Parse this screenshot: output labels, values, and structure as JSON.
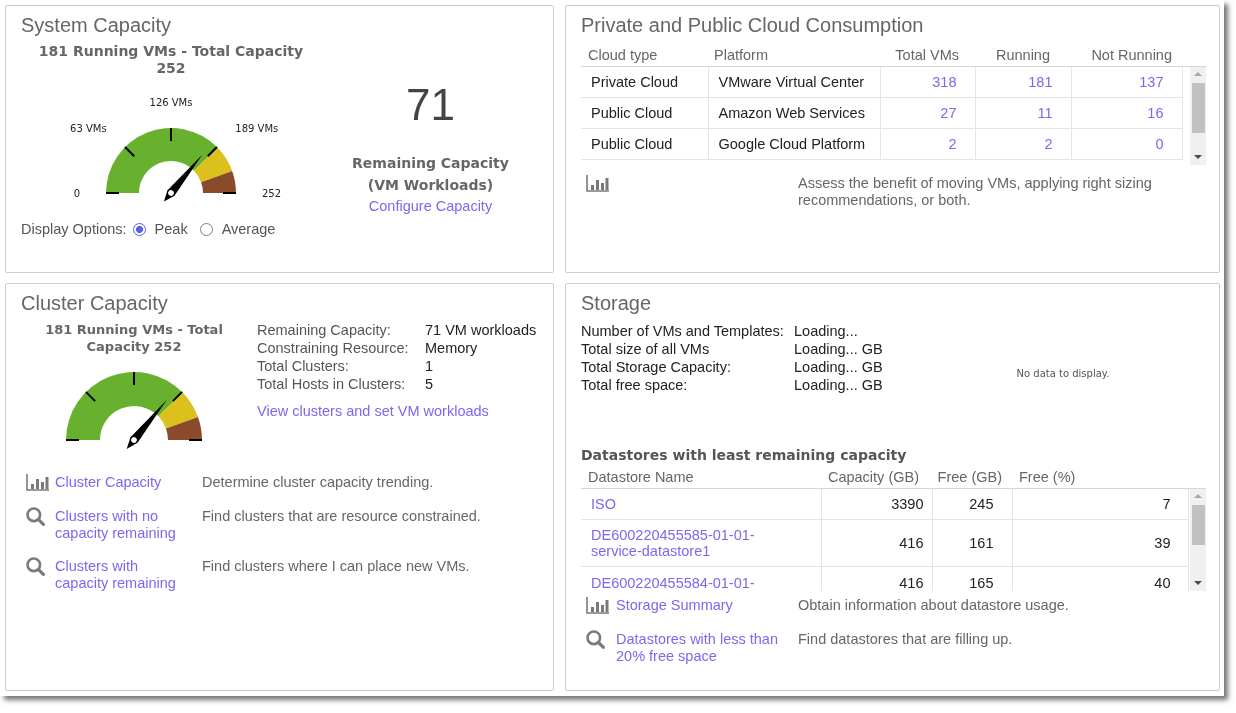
{
  "system_capacity": {
    "title": "System Capacity",
    "gauge": {
      "caption": "181 Running VMs - Total Capacity 252",
      "tick_labels": [
        "0",
        "63 VMs",
        "126 VMs",
        "189 VMs",
        "252"
      ],
      "level": 0.718
    },
    "display_options": {
      "label": "Display Options:",
      "options": [
        {
          "label": "Peak",
          "selected": true
        },
        {
          "label": "Average",
          "selected": false
        }
      ]
    },
    "remaining": {
      "value": "71",
      "label": "Remaining Capacity (VM Workloads)",
      "link": "Configure Capacity"
    }
  },
  "cloud_consumption": {
    "title": "Private and Public Cloud Consumption",
    "table": {
      "columns": [
        "Cloud type",
        "Platform",
        "Total VMs",
        "Running",
        "Not Running"
      ],
      "rows": [
        {
          "cloud_type": "Private Cloud",
          "platform": "VMware Virtual Center",
          "total_vms": "318",
          "running": "181",
          "not_running": "137"
        },
        {
          "cloud_type": "Public Cloud",
          "platform": "Amazon Web Services",
          "total_vms": "27",
          "running": "11",
          "not_running": "16"
        },
        {
          "cloud_type": "Public Cloud",
          "platform": "Google Cloud Platform",
          "total_vms": "2",
          "running": "2",
          "not_running": "0"
        }
      ]
    },
    "reports": [
      {
        "kind": "chart",
        "description": "Assess the benefit of moving VMs, applying right sizing recommendations, or both."
      }
    ]
  },
  "cluster_capacity": {
    "title": "Cluster Capacity",
    "gauge": {
      "caption": "181 Running VMs - Total Capacity 252",
      "level": 0.718
    },
    "details": [
      {
        "label": "Remaining Capacity:",
        "value": "71 VM workloads"
      },
      {
        "label": "Constraining Resource:",
        "value": "Memory"
      },
      {
        "label": "Total Clusters:",
        "value": "1"
      },
      {
        "label": "Total Hosts in Clusters:",
        "value": "5"
      }
    ],
    "link": "View clusters and set VM workloads",
    "reports": [
      {
        "kind": "chart",
        "link": "Cluster Capacity",
        "description": "Determine cluster capacity trending."
      },
      {
        "kind": "search",
        "link": "Clusters with no capacity remaining",
        "description": "Find clusters that are resource constrained."
      },
      {
        "kind": "search",
        "link": "Clusters with capacity remaining",
        "description": "Find clusters where I can place new VMs."
      }
    ]
  },
  "storage": {
    "title": "Storage",
    "details": [
      {
        "label": "Number of VMs and Templates:",
        "value": "Loading..."
      },
      {
        "label": "Total size of all VMs",
        "value": "Loading... GB"
      },
      {
        "label": "Total Storage Capacity:",
        "value": "Loading... GB"
      },
      {
        "label": "Total free space:",
        "value": "Loading... GB"
      }
    ],
    "chart_message": "No data to display.",
    "datastores": {
      "title": "Datastores with least remaining capacity",
      "columns": [
        "Datastore Name",
        "Capacity (GB)",
        "Free (GB)",
        "Free (%)"
      ],
      "rows": [
        {
          "name": "ISO",
          "capacity": "3390",
          "free_gb": "245",
          "free_pct": "7"
        },
        {
          "name": "DE600220455585-01-01-service-datastore1",
          "capacity": "416",
          "free_gb": "161",
          "free_pct": "39"
        },
        {
          "name": "DE600220455584-01-01-",
          "capacity": "416",
          "free_gb": "165",
          "free_pct": "40"
        }
      ]
    },
    "reports": [
      {
        "kind": "chart",
        "link": "Storage Summary",
        "description": "Obtain information about datastore usage."
      },
      {
        "kind": "search",
        "link": "Datastores with less than 20% free space",
        "description": "Find datastores that are filling up."
      }
    ]
  }
}
